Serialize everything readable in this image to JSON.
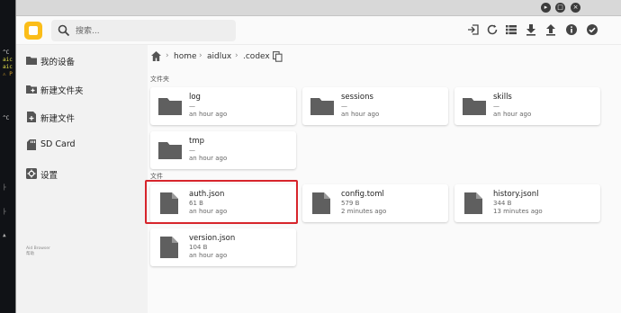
{
  "terminal": {
    "lines": [
      "^C",
      "aic",
      "aic",
      "⚠ P",
      "^C",
      "├",
      "├",
      "▲"
    ]
  },
  "toolbar": {
    "search_placeholder": "搜索...",
    "buttons": [
      "import-icon",
      "refresh-icon",
      "list-view-icon",
      "download-icon",
      "upload-icon",
      "info-icon",
      "check-icon"
    ]
  },
  "sidebar": {
    "items": [
      {
        "label": "我的设备",
        "icon": "folder-icon"
      },
      {
        "label": "新建文件夹",
        "icon": "new-folder-icon"
      },
      {
        "label": "新建文件",
        "icon": "new-file-icon"
      },
      {
        "label": "SD Card",
        "icon": "sd-card-icon"
      },
      {
        "label": "设置",
        "icon": "settings-icon"
      }
    ],
    "footer_line1": "Aid Browser",
    "footer_line2": "帮助"
  },
  "breadcrumb": {
    "parts": [
      "home",
      "aidlux",
      ".codex"
    ],
    "separator": "›"
  },
  "sections": {
    "folders_label": "文件夹",
    "files_label": "文件"
  },
  "folders": [
    {
      "name": "log",
      "sub": "—",
      "time": "an hour ago"
    },
    {
      "name": "sessions",
      "sub": "—",
      "time": "an hour ago"
    },
    {
      "name": "skills",
      "sub": "—",
      "time": "an hour ago"
    },
    {
      "name": "tmp",
      "sub": "—",
      "time": "an hour ago"
    }
  ],
  "files": [
    {
      "name": "auth.json",
      "size": "61 B",
      "time": "an hour ago"
    },
    {
      "name": "config.toml",
      "size": "579 B",
      "time": "2 minutes ago"
    },
    {
      "name": "history.jsonl",
      "size": "344 B",
      "time": "13 minutes ago"
    },
    {
      "name": "version.json",
      "size": "104 B",
      "time": "an hour ago"
    }
  ],
  "colors": {
    "accent_yellow": "#fbbd19",
    "highlight_red": "#d7252c",
    "icon_gray": "#5f5f5f"
  }
}
